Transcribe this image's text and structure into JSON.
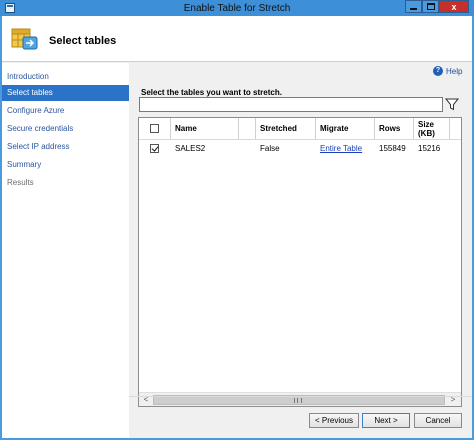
{
  "window": {
    "title": "Enable Table for Stretch",
    "close_glyph": "x"
  },
  "header": {
    "title": "Select tables",
    "icon": "table-wizard-icon"
  },
  "nav": {
    "items": [
      {
        "label": "Introduction",
        "state": "normal"
      },
      {
        "label": "Select tables",
        "state": "active"
      },
      {
        "label": "Configure Azure",
        "state": "normal"
      },
      {
        "label": "Secure credentials",
        "state": "normal"
      },
      {
        "label": "Select IP address",
        "state": "normal"
      },
      {
        "label": "Summary",
        "state": "normal"
      },
      {
        "label": "Results",
        "state": "disabled"
      }
    ]
  },
  "help": {
    "label": "Help",
    "glyph": "?"
  },
  "main": {
    "prompt": "Select the tables you want to stretch.",
    "search_value": "",
    "filter_icon": "filter-icon"
  },
  "grid": {
    "columns": [
      "",
      "Name",
      "",
      "Stretched",
      "Migrate",
      "Rows",
      "Size (KB)"
    ],
    "rows": [
      {
        "checked": true,
        "name": "SALES2",
        "stretched": "False",
        "migrate": "Entire Table",
        "rows": "155849",
        "size": "15216"
      }
    ]
  },
  "scrollbar": {
    "left_arrow": "<",
    "right_arrow": ">"
  },
  "buttons": {
    "previous": "< Previous",
    "next": "Next >",
    "cancel": "Cancel"
  },
  "colors": {
    "titlebar": "#3d8fd8",
    "nav_active": "#2a73c9",
    "link": "#1a3fb8",
    "close": "#c7302a"
  }
}
